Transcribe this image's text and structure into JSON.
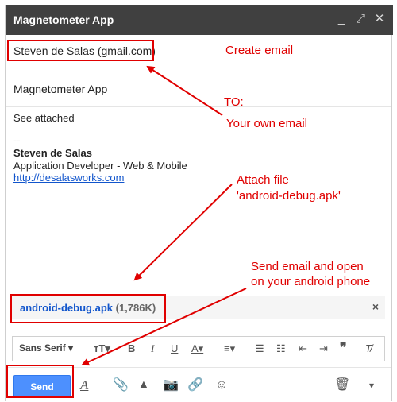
{
  "window": {
    "title": "Magnetometer App",
    "minimize": "_",
    "popout": "⤢",
    "close": "✕"
  },
  "compose": {
    "to": "Steven de Salas (gmail.com)",
    "subject": "Magnetometer App",
    "body": {
      "line1": "See attached",
      "sep": "--",
      "sig_name": "Steven de Salas",
      "sig_title": "Application Developer - Web & Mobile",
      "sig_link": "http://desalasworks.com"
    },
    "attachment": {
      "name": "android-debug.apk",
      "size": "(1,786K)",
      "remove": "×"
    }
  },
  "format_toolbar": {
    "font": "Sans Serif"
  },
  "bottom_toolbar": {
    "send_label": "Send"
  },
  "annotations": {
    "create": "Create email",
    "to_label": "TO:",
    "to_desc": "Your own email",
    "attach_1": "Attach file",
    "attach_2": "'android-debug.apk'",
    "send_1": "Send email and open",
    "send_2": "on your android phone"
  },
  "colors": {
    "annotation": "#e00000",
    "send": "#4d90fe",
    "titlebar": "#404040",
    "link": "#1155cc"
  }
}
